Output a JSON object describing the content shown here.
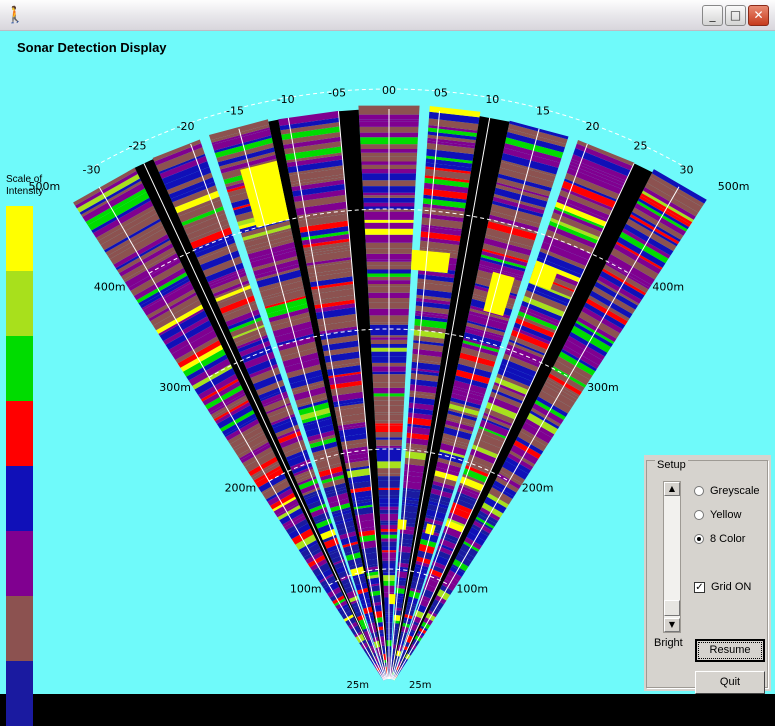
{
  "window": {
    "title": "",
    "buttons": {
      "minimize": "_",
      "maximize": "□",
      "close": "✕"
    }
  },
  "app": {
    "title": "Sonar Detection Display"
  },
  "scale": {
    "label_line1": "Scale of",
    "label_line2": "Intensity",
    "colors": [
      "#ffff00",
      "#a8e01c",
      "#00dc00",
      "#ff0000",
      "#1010b8",
      "#800090",
      "#8c5250",
      "#1a1aa0"
    ]
  },
  "sonar": {
    "range_max_m": 500,
    "bearing_range": [
      -30,
      30
    ],
    "bearing_labels": [
      "-30",
      "-25",
      "-20",
      "-15",
      "-10",
      "-05",
      "00",
      "05",
      "10",
      "15",
      "20",
      "25",
      "30"
    ],
    "range_labels": [
      "100m",
      "200m",
      "300m",
      "400m",
      "500m"
    ],
    "bottom_labels": [
      "25m",
      "25m"
    ],
    "grid_on": true
  },
  "setup": {
    "legend": "Setup",
    "options": [
      {
        "label": "Greyscale",
        "selected": false
      },
      {
        "label": "Yellow",
        "selected": false
      },
      {
        "label": "8 Color",
        "selected": true
      }
    ],
    "grid_label": "Grid ON",
    "grid_checked": true,
    "bright_label": "Bright",
    "brightness_level": 0.9,
    "resume_label": "Resume",
    "quit_label": "Quit"
  }
}
